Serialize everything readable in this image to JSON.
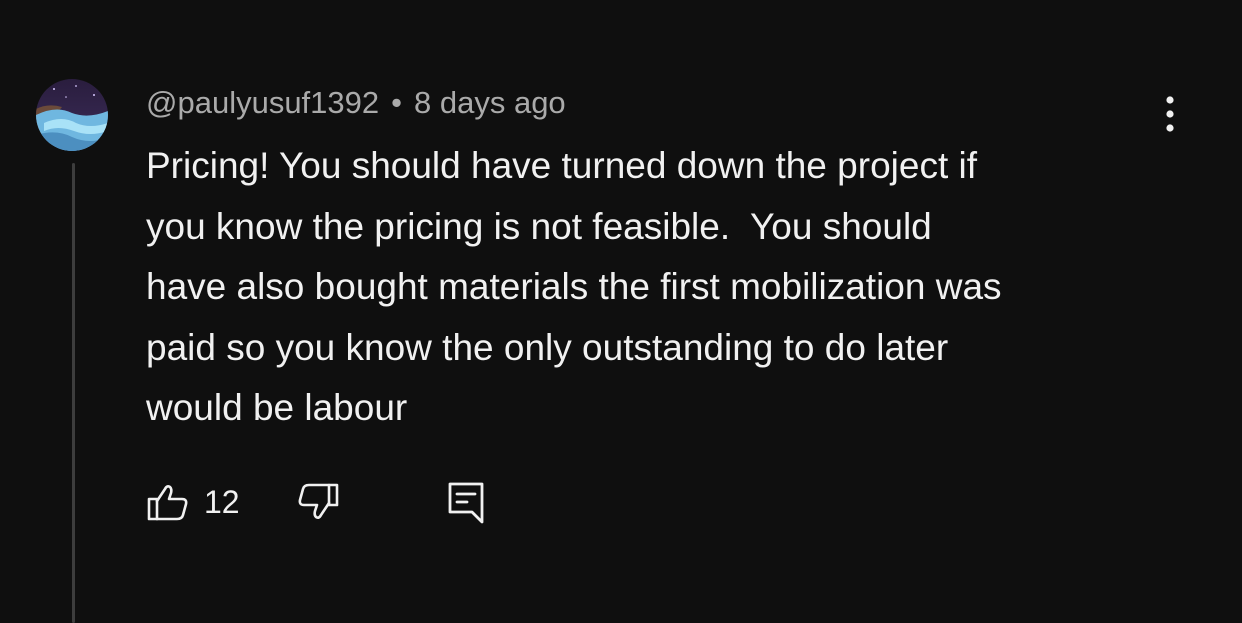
{
  "comment": {
    "author": "@paulyusuf1392",
    "separator": "•",
    "timestamp": "8 days ago",
    "text": "Pricing! You should have turned down the project if\nyou know the pricing is not feasible.  You should\nhave also bought materials the first mobilization was\npaid so you know the only outstanding to do later\nwould be labour",
    "like_count": "12"
  },
  "icons": {
    "menu": "more-vertical-icon",
    "like": "thumbs-up-icon",
    "dislike": "thumbs-down-icon",
    "reply": "reply-comment-icon"
  },
  "colors": {
    "background": "#0f0f0f",
    "primary_text": "#f1f1f1",
    "secondary_text": "#aaaaaa",
    "thread_line": "#3d3d3d"
  }
}
